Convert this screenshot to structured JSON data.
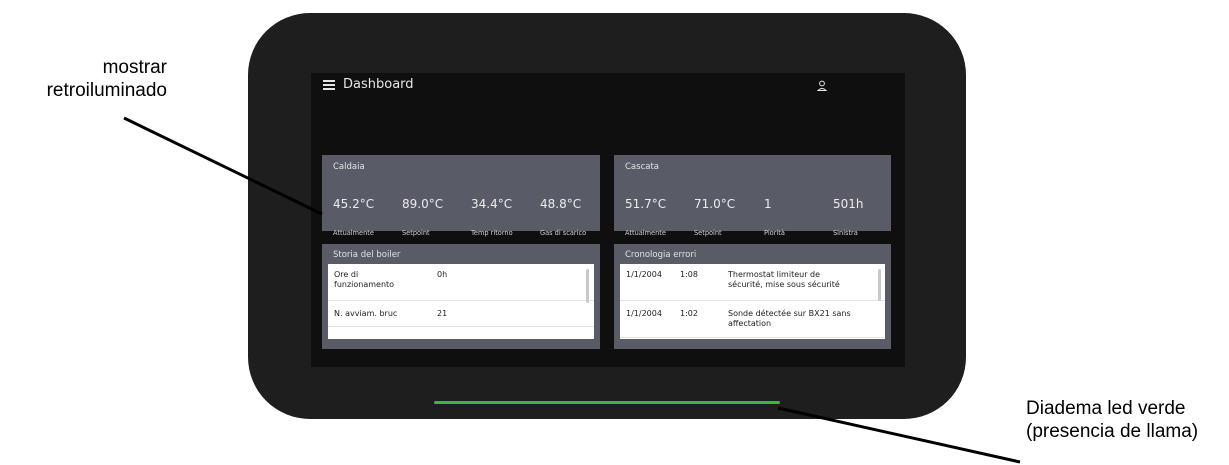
{
  "annotations": {
    "display_line1": "mostrar",
    "display_line2": "retroiluminado",
    "led_line1": "Diadema led verde",
    "led_line2": "(presencia de llama)"
  },
  "colors": {
    "device_body": "#1e1e1e",
    "screen": "#0f0f0f",
    "card": "#595c66",
    "led": "#39b54a"
  },
  "screen": {
    "appbar": {
      "menu_icon": "hamburger-menu-icon",
      "title": "Dashboard",
      "user_icon": "user-icon"
    },
    "caldaia": {
      "title": "Caldaia",
      "metrics": [
        {
          "value": "45.2°C",
          "label": "Attualmente"
        },
        {
          "value": "89.0°C",
          "label": "Setpoint"
        },
        {
          "value": "34.4°C",
          "label": "Temp ritorno"
        },
        {
          "value": "48.8°C",
          "label": "Gas di scarico"
        }
      ]
    },
    "cascata": {
      "title": "Cascata",
      "metrics": [
        {
          "value": "51.7°C",
          "label": "Attualmente"
        },
        {
          "value": "71.0°C",
          "label": "Setpoint"
        },
        {
          "value": "1",
          "label": "Piorità"
        },
        {
          "value": "501h",
          "label": "Sinistra"
        }
      ]
    },
    "boiler_history": {
      "title": "Storia del boiler",
      "rows": [
        {
          "label_line1": "Ore di",
          "label_line2": "funzionamento",
          "value": "0h"
        },
        {
          "label_line1": "N. avviam. bruc",
          "label_line2": "",
          "value": "21"
        }
      ]
    },
    "error_log": {
      "title": "Cronologia errori",
      "rows": [
        {
          "date": "1/1/2004",
          "time": "1:08",
          "line1": "Thermostat limiteur de",
          "line2": "sécurité, mise sous sécurité"
        },
        {
          "date": "1/1/2004",
          "time": "1:02",
          "line1": "Sonde détectée sur BX21 sans",
          "line2": "affectation"
        }
      ]
    }
  }
}
